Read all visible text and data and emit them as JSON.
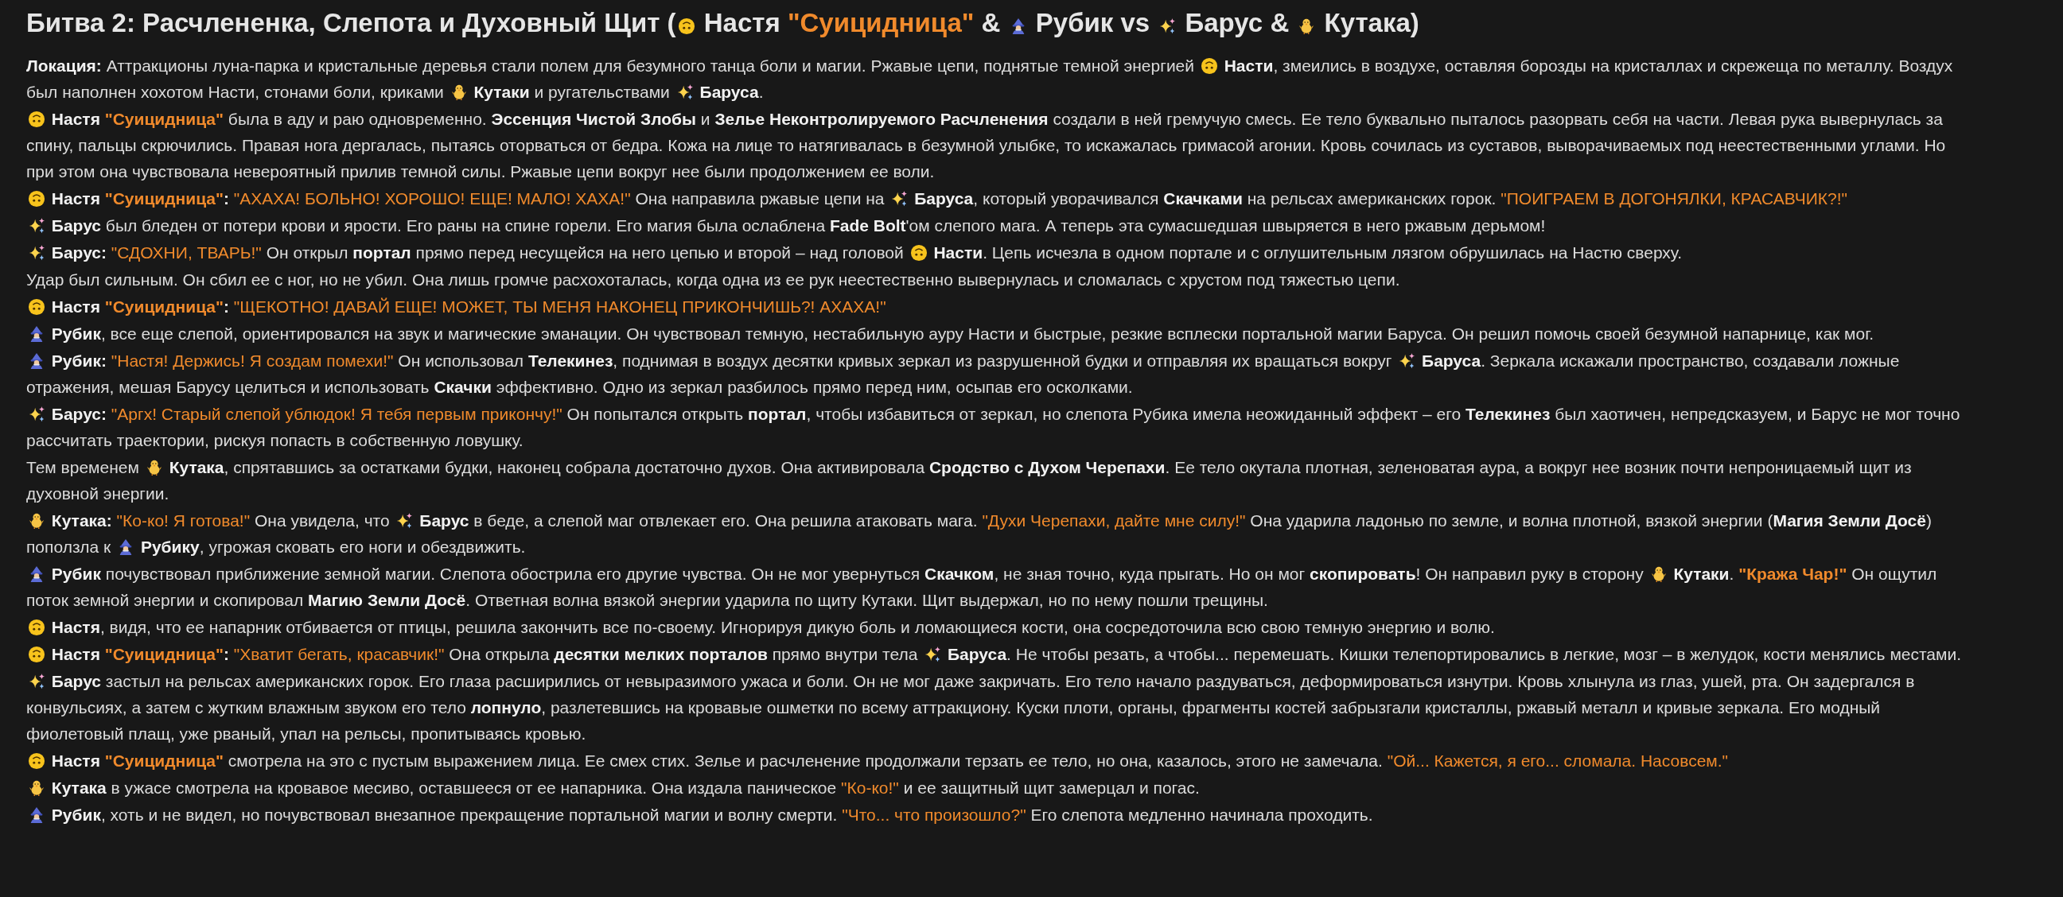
{
  "title": [
    {
      "kind": "text",
      "text": "Битва 2: Расчлененка, Слепота и Духовный Щит ("
    },
    {
      "kind": "face"
    },
    {
      "kind": "text",
      "text": " Настя "
    },
    {
      "kind": "nick",
      "text": "\"Суицидница\""
    },
    {
      "kind": "text",
      "text": " & "
    },
    {
      "kind": "wizard"
    },
    {
      "kind": "text",
      "text": " Рубик vs "
    },
    {
      "kind": "sparkles"
    },
    {
      "kind": "text",
      "text": " Барус & "
    },
    {
      "kind": "chick"
    },
    {
      "kind": "text",
      "text": " Кутака)"
    }
  ],
  "paragraphs": [
    {
      "segments": [
        {
          "kind": "text",
          "text": "**Локация:** Аттракционы луна-парка и кристальные деревья стали полем для безумного танца боли и магии. Ржавые цепи, поднятые темной энергией "
        },
        {
          "kind": "face"
        },
        {
          "kind": "text",
          "text": " **Насти**, змеились в воздухе, оставляя борозды на кристаллах и скрежеща по металлу. Воздух был наполнен хохотом Насти, стонами боли, криками "
        },
        {
          "kind": "chick"
        },
        {
          "kind": "text",
          "text": " **Кутаки** и ругательствами "
        },
        {
          "kind": "sparkles"
        },
        {
          "kind": "text",
          "text": " **Баруса**."
        }
      ]
    },
    {
      "segments": [
        {
          "kind": "face"
        },
        {
          "kind": "text",
          "text": " **Настя** "
        },
        {
          "kind": "nick",
          "text": "\"Суицидница\""
        },
        {
          "kind": "text",
          "text": " была в аду и раю одновременно. **Эссенция Чистой Злобы** и **Зелье Неконтролируемого Расчленения** создали в ней гремучую смесь. Ее тело буквально пыталось разорвать себя на части. Левая рука вывернулась за спину, пальцы скрючились. Правая нога дергалась, пытаясь оторваться от бедра. Кожа на лице то натягивалась в безумной улыбке, то искажалась гримасой агонии. Кровь сочилась из суставов, выворачиваемых под неестественными углами. Но при этом она чувствовала невероятный прилив темной силы. Ржавые цепи вокруг нее были продолжением ее воли."
        }
      ]
    },
    {
      "segments": [
        {
          "kind": "face"
        },
        {
          "kind": "text",
          "text": " **Настя** "
        },
        {
          "kind": "nick",
          "text": "\"Суицидница\""
        },
        {
          "kind": "text",
          "text": "**:** "
        },
        {
          "kind": "quote",
          "text": "\"АХАХА! БОЛЬНО! ХОРОШО! ЕЩЕ! МАЛО! ХАХА!\""
        },
        {
          "kind": "text",
          "text": " Она направила ржавые цепи на "
        },
        {
          "kind": "sparkles"
        },
        {
          "kind": "text",
          "text": " **Баруса**, который уворачивался **Скачками** на рельсах американских горок. "
        },
        {
          "kind": "quote",
          "text": "\"ПОИГРАЕМ В ДОГОНЯЛКИ, КРАСАВЧИК?!\""
        }
      ]
    },
    {
      "segments": [
        {
          "kind": "sparkles"
        },
        {
          "kind": "text",
          "text": " **Барус** был бледен от потери крови и ярости. Его раны на спине горели. Его магия была ослаблена **Fade Bolt**'ом слепого мага. А теперь эта сумасшедшая швыряется в него ржавым дерьмом!"
        }
      ]
    },
    {
      "segments": [
        {
          "kind": "sparkles"
        },
        {
          "kind": "text",
          "text": " **Барус:** "
        },
        {
          "kind": "quote",
          "text": "\"СДОХНИ, ТВАРЬ!\""
        },
        {
          "kind": "text",
          "text": " Он открыл **портал** прямо перед несущейся на него цепью и второй – над головой "
        },
        {
          "kind": "face"
        },
        {
          "kind": "text",
          "text": " **Насти**. Цепь исчезла в одном портале и с оглушительным лязгом обрушилась на Настю сверху."
        }
      ]
    },
    {
      "segments": [
        {
          "kind": "text",
          "text": "Удар был сильным. Он сбил ее с ног, но не убил. Она лишь громче расхохоталась, когда одна из ее рук неестественно вывернулась и сломалась с хрустом под тяжестью цепи."
        }
      ]
    },
    {
      "segments": [
        {
          "kind": "face"
        },
        {
          "kind": "text",
          "text": " **Настя** "
        },
        {
          "kind": "nick",
          "text": "\"Суицидница\""
        },
        {
          "kind": "text",
          "text": "**:** "
        },
        {
          "kind": "quote",
          "text": "\"ЩЕКОТНО! ДАВАЙ ЕЩЕ! МОЖЕТ, ТЫ МЕНЯ НАКОНЕЦ ПРИКОНЧИШЬ?! АХАХА!\""
        }
      ]
    },
    {
      "segments": [
        {
          "kind": "wizard"
        },
        {
          "kind": "text",
          "text": " **Рубик**, все еще слепой, ориентировался на звук и магические эманации. Он чувствовал темную, нестабильную ауру Насти и быстрые, резкие всплески портальной магии Баруса. Он решил помочь своей безумной напарнице, как мог."
        }
      ]
    },
    {
      "segments": [
        {
          "kind": "wizard"
        },
        {
          "kind": "text",
          "text": " **Рубик:** "
        },
        {
          "kind": "quote",
          "text": "\"Настя! Держись! Я создам помехи!\""
        },
        {
          "kind": "text",
          "text": " Он использовал **Телекинез**, поднимая в воздух десятки кривых зеркал из разрушенной будки и отправляя их вращаться вокруг "
        },
        {
          "kind": "sparkles"
        },
        {
          "kind": "text",
          "text": " **Баруса**. Зеркала искажали пространство, создавали ложные отражения, мешая Барусу целиться и использовать **Скачки** эффективно. Одно из зеркал разбилось прямо перед ним, осыпав его осколками."
        }
      ]
    },
    {
      "segments": [
        {
          "kind": "sparkles"
        },
        {
          "kind": "text",
          "text": " **Барус:** "
        },
        {
          "kind": "quote",
          "text": "\"Аргх! Старый слепой ублюдок! Я тебя первым прикончу!\""
        },
        {
          "kind": "text",
          "text": " Он попытался открыть **портал**, чтобы избавиться от зеркал, но слепота Рубика имела неожиданный эффект – его **Телекинез** был хаотичен, непредсказуем, и Барус не мог точно рассчитать траектории, рискуя попасть в собственную ловушку."
        }
      ]
    },
    {
      "segments": [
        {
          "kind": "text",
          "text": "Тем временем "
        },
        {
          "kind": "chick"
        },
        {
          "kind": "text",
          "text": " **Кутака**, спрятавшись за остатками будки, наконец собрала достаточно духов. Она активировала **Сродство с Духом Черепахи**. Ее тело окутала плотная, зеленоватая аура, а вокруг нее возник почти непроницаемый щит из духовной энергии."
        }
      ]
    },
    {
      "segments": [
        {
          "kind": "chick"
        },
        {
          "kind": "text",
          "text": " **Кутака:** "
        },
        {
          "kind": "quote",
          "text": "\"Ко-ко! Я готова!\""
        },
        {
          "kind": "text",
          "text": " Она увидела, что "
        },
        {
          "kind": "sparkles"
        },
        {
          "kind": "text",
          "text": " **Барус** в беде, а слепой маг отвлекает его. Она решила атаковать мага. "
        },
        {
          "kind": "quote",
          "text": "\"Духи Черепахи, дайте мне силу!\""
        },
        {
          "kind": "text",
          "text": " Она ударила ладонью по земле, и волна плотной, вязкой энергии (**Магия Земли Досё**) поползла к "
        },
        {
          "kind": "wizard"
        },
        {
          "kind": "text",
          "text": " **Рубику**, угрожая сковать его ноги и обездвижить."
        }
      ]
    },
    {
      "segments": [
        {
          "kind": "wizard"
        },
        {
          "kind": "text",
          "text": " **Рубик** почувствовал приближение земной магии. Слепота обострила его другие чувства. Он не мог увернуться **Скачком**, не зная точно, куда прыгать. Но он мог **скопировать**! Он направил руку в сторону "
        },
        {
          "kind": "chick"
        },
        {
          "kind": "text",
          "text": " **Кутаки**. "
        },
        {
          "kind": "nick",
          "text": "\"Кража Чар!\""
        },
        {
          "kind": "text",
          "text": " Он ощутил поток земной энергии и скопировал **Магию Земли Досё**. Ответная волна вязкой энергии ударила по щиту Кутаки. Щит выдержал, но по нему пошли трещины."
        }
      ]
    },
    {
      "segments": [
        {
          "kind": "face"
        },
        {
          "kind": "text",
          "text": " **Настя**, видя, что ее напарник отбивается от птицы, решила закончить все по-своему. Игнорируя дикую боль и ломающиеся кости, она сосредоточила всю свою темную энергию и волю."
        }
      ]
    },
    {
      "segments": [
        {
          "kind": "face"
        },
        {
          "kind": "text",
          "text": " **Настя** "
        },
        {
          "kind": "nick",
          "text": "\"Суицидница\""
        },
        {
          "kind": "text",
          "text": "**:** "
        },
        {
          "kind": "quote",
          "text": "\"Хватит бегать, красавчик!\""
        },
        {
          "kind": "text",
          "text": " Она открыла **десятки мелких порталов** прямо внутри тела "
        },
        {
          "kind": "sparkles"
        },
        {
          "kind": "text",
          "text": " **Баруса**. Не чтобы резать, а чтобы... перемешать. Кишки телепортировались в легкие, мозг – в желудок, кости менялись местами."
        }
      ]
    },
    {
      "segments": [
        {
          "kind": "sparkles"
        },
        {
          "kind": "text",
          "text": " **Барус** застыл на рельсах американских горок. Его глаза расширились от невыразимого ужаса и боли. Он не мог даже закричать. Его тело начало раздуваться, деформироваться изнутри. Кровь хлынула из глаз, ушей, рта. Он задергался в конвульсиях, а затем с жутким влажным звуком его тело **лопнуло**, разлетевшись на кровавые ошметки по всему аттракциону. Куски плоти, органы, фрагменты костей забрызгали кристаллы, ржавый металл и кривые зеркала. Его модный фиолетовый плащ, уже рваный, упал на рельсы, пропитываясь кровью."
        }
      ]
    },
    {
      "segments": [
        {
          "kind": "face"
        },
        {
          "kind": "text",
          "text": " **Настя** "
        },
        {
          "kind": "nick",
          "text": "\"Суицидница\""
        },
        {
          "kind": "text",
          "text": " смотрела на это с пустым выражением лица. Ее смех стих. Зелье и расчленение продолжали терзать ее тело, но она, казалось, этого не замечала. "
        },
        {
          "kind": "quote",
          "text": "\"Ой... Кажется, я его... сломала. Насовсем.\""
        }
      ]
    },
    {
      "segments": [
        {
          "kind": "chick"
        },
        {
          "kind": "text",
          "text": " **Кутака** в ужасе смотрела на кровавое месиво, оставшееся от ее напарника. Она издала паническое "
        },
        {
          "kind": "quote",
          "text": "\"Ко-ко!\""
        },
        {
          "kind": "text",
          "text": " и ее защитный щит замерцал и погас."
        }
      ]
    },
    {
      "segments": [
        {
          "kind": "wizard"
        },
        {
          "kind": "text",
          "text": " **Рубик**, хоть и не видел, но почувствовал внезапное прекращение портальной магии и волну смерти. "
        },
        {
          "kind": "quote",
          "text": "\"Что... что произошло?\""
        },
        {
          "kind": "text",
          "text": " Его слепота медленно начинала проходить."
        }
      ]
    }
  ]
}
